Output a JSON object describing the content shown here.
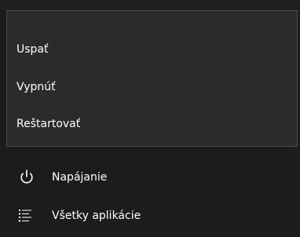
{
  "power_menu": {
    "items": [
      {
        "label": "Uspať"
      },
      {
        "label": "Vypnúť"
      },
      {
        "label": "Reštartovať"
      }
    ]
  },
  "start_menu": {
    "power": {
      "label": "Napájanie",
      "icon": "power-icon"
    },
    "all_apps": {
      "label": "Všetky aplikácie",
      "icon": "all-apps-icon"
    }
  },
  "colors": {
    "background": "#1c1c1c",
    "flyout_background": "#2b2b2b",
    "flyout_border": "#4a4a4a",
    "text": "#ffffff"
  }
}
